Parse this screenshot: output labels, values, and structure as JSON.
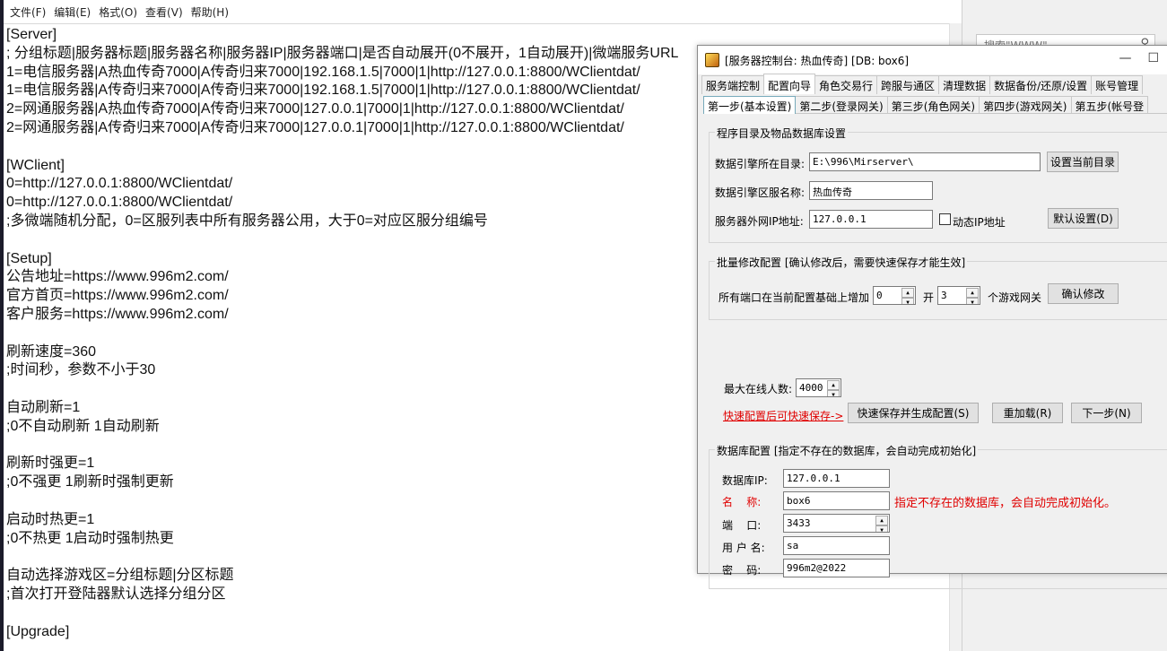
{
  "notepad": {
    "menu": [
      "文件(F)",
      "编辑(E)",
      "格式(O)",
      "查看(V)",
      "帮助(H)"
    ],
    "lines": [
      "[Server]",
      "; 分组标题|服务器标题|服务器名称|服务器IP|服务器端口|是否自动展开(0不展开，1自动展开)|微端服务URL",
      "1=电信服务器|A热血传奇7000|A传奇归来7000|192.168.1.5|7000|1|http://127.0.0.1:8800/WClientdat/",
      "1=电信服务器|A传奇归来7000|A传奇归来7000|192.168.1.5|7000|1|http://127.0.0.1:8800/WClientdat/",
      "2=网通服务器|A热血传奇7000|A传奇归来7000|127.0.0.1|7000|1|http://127.0.0.1:8800/WClientdat/",
      "2=网通服务器|A传奇归来7000|A传奇归来7000|127.0.0.1|7000|1|http://127.0.0.1:8800/WClientdat/",
      "",
      "[WClient]",
      "0=http://127.0.0.1:8800/WClientdat/",
      "0=http://127.0.0.1:8800/WClientdat/",
      ";多微端随机分配，0=区服列表中所有服务器公用，大于0=对应区服分组编号",
      "",
      "[Setup]",
      "公告地址=https://www.996m2.com/",
      "官方首页=https://www.996m2.com/",
      "客户服务=https://www.996m2.com/",
      "",
      "刷新速度=360",
      ";时间秒，参数不小于30",
      "",
      "自动刷新=1",
      ";0不自动刷新 1自动刷新",
      "",
      "刷新时强更=1",
      ";0不强更 1刷新时强制更新",
      "",
      "启动时热更=1",
      ";0不热更 1启动时强制热更",
      "",
      "自动选择游戏区=分组标题|分区标题",
      ";首次打开登陆器默认选择分组分区",
      "",
      "[Upgrade]"
    ]
  },
  "right": {
    "search_placeholder": "搜索\"WWW\""
  },
  "dialog": {
    "title": "[服务器控制台: 热血传奇] [DB: box6]",
    "title_buttons": [
      "—",
      "☐"
    ],
    "main_tabs": [
      "服务端控制",
      "配置向导",
      "角色交易行",
      "跨服与通区",
      "清理数据",
      "数据备份/还原/设置",
      "账号管理"
    ],
    "active_main_tab": 1,
    "sub_tabs": [
      "第一步(基本设置)",
      "第二步(登录网关)",
      "第三步(角色网关)",
      "第四步(游戏网关)",
      "第五步(帐号登"
    ],
    "active_sub_tab": 0,
    "group1": {
      "title": "程序目录及物品数据库设置",
      "dir_label": "数据引擎所在目录:",
      "dir_value": "E:\\996\\Mirserver\\",
      "set_dir_button": "设置当前目录",
      "server_name_label": "数据引擎区服名称:",
      "server_name_value": "热血传奇",
      "ip_label": "服务器外网IP地址:",
      "ip_value": "127.0.0.1",
      "dynamic_ip_label": "动态IP地址",
      "default_button": "默认设置(D)"
    },
    "group2": {
      "title": "批量修改配置 [确认修改后，需要快速保存才能生效]",
      "prefix_label": "所有端口在当前配置基础上增加",
      "increase_value": "0",
      "open_label": "开",
      "gateway_count": "3",
      "suffix_label": "个游戏网关",
      "confirm_button": "确认修改"
    },
    "max_online_label": "最大在线人数:",
    "max_online_value": "4000",
    "quick_save_link": "快速配置后可快速保存->",
    "quick_save_button": "快速保存并生成配置(S)",
    "reload_button": "重加载(R)",
    "next_button": "下一步(N)",
    "group3": {
      "title": "数据库配置 [指定不存在的数据库，会自动完成初始化]",
      "db_ip_label": "数据库IP:",
      "db_ip_value": "127.0.0.1",
      "name_label": "名    称:",
      "name_value": "box6",
      "name_hint": "指定不存在的数据库，会自动完成初始化。",
      "port_label": "端    口:",
      "port_value": "3433",
      "user_label": "用 户 名:",
      "user_value": "sa",
      "password_label": "密    码:",
      "password_value": "996m2@2022"
    },
    "colors": {
      "hint_red": "#e00000",
      "active_subtab_border": "#77aabb"
    }
  }
}
